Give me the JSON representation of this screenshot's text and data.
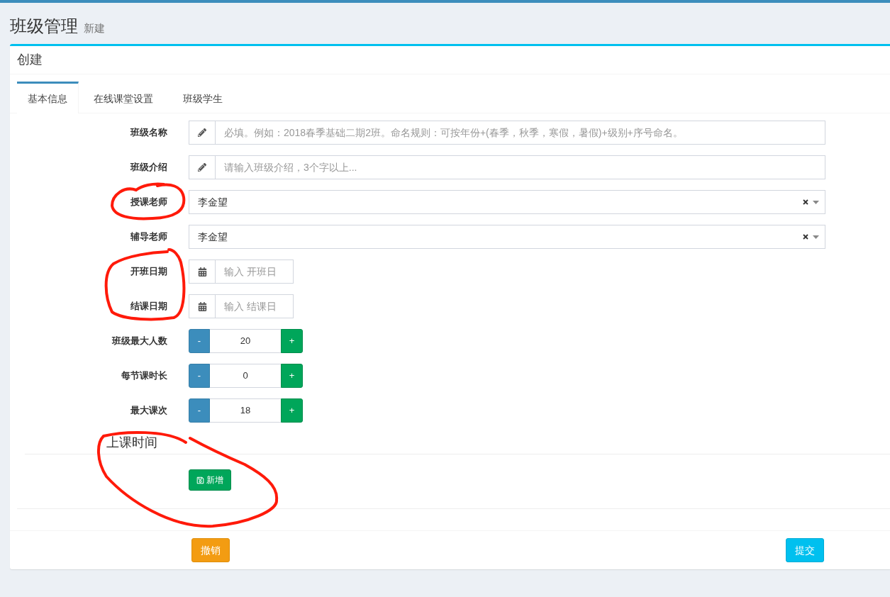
{
  "header": {
    "title": "班级管理",
    "subtitle": "新建"
  },
  "box_title": "创建",
  "tabs": [
    {
      "label": "基本信息",
      "selected": true
    },
    {
      "label": "在线课堂设置",
      "selected": false
    },
    {
      "label": "班级学生",
      "selected": false
    }
  ],
  "fields": [
    {
      "kind": "text",
      "label": "班级名称",
      "placeholder": "必填。例如：2018春季基础二期2班。命名规则：可按年份+(春季，秋季，寒假，暑假)+级别+序号命名。"
    },
    {
      "kind": "text",
      "label": "班级介绍",
      "placeholder": "请输入班级介绍，3个字以上..."
    },
    {
      "kind": "select",
      "label": "授课老师",
      "value": "李金望"
    },
    {
      "kind": "select",
      "label": "辅导老师",
      "value": "李金望"
    },
    {
      "kind": "date",
      "label": "开班日期",
      "placeholder": "输入 开班日"
    },
    {
      "kind": "date",
      "label": "结课日期",
      "placeholder": "输入 结课日"
    },
    {
      "kind": "stepper",
      "label": "班级最大人数",
      "value": "20",
      "minus": "-",
      "plus": "+"
    },
    {
      "kind": "stepper",
      "label": "每节课时长",
      "value": "0",
      "minus": "-",
      "plus": "+"
    },
    {
      "kind": "stepper",
      "label": "最大课次",
      "value": "18",
      "minus": "-",
      "plus": "+"
    }
  ],
  "schedule": {
    "title": "上课时间",
    "add_button": "新增"
  },
  "footer": {
    "cancel_button": "撤销",
    "submit_button": "提交"
  }
}
